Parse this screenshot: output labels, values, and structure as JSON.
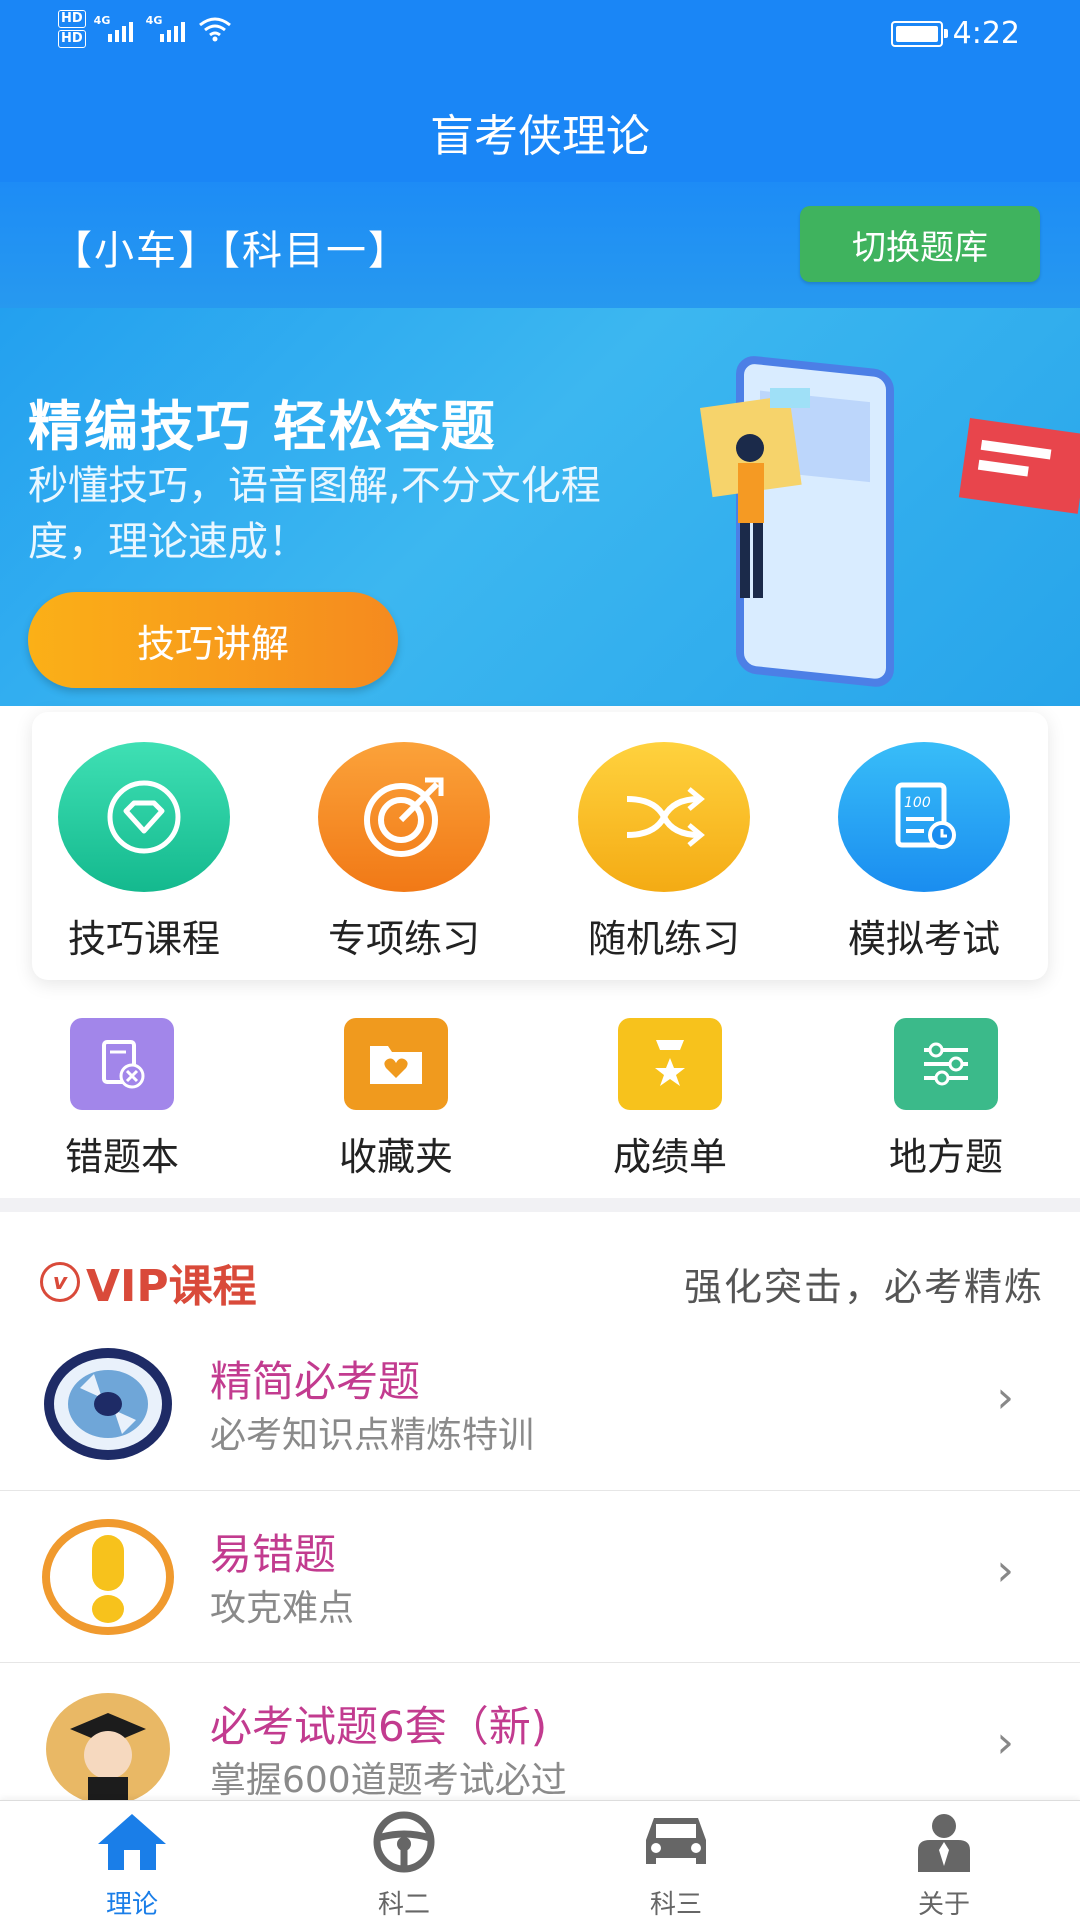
{
  "status": {
    "time": "4:22",
    "hd1": "HD",
    "hd2": "HD",
    "net1": "4G",
    "net2": "4G"
  },
  "app": {
    "title": "盲考侠理论"
  },
  "subject": {
    "label": "【小车】【科目一】",
    "switch": "切换题库"
  },
  "banner": {
    "title": "精编技巧 轻松答题",
    "subtitle": "秒懂技巧，语音图解,不分文化程度，理论速成！",
    "button": "技巧讲解"
  },
  "functions": [
    {
      "label": "技巧课程",
      "icon": "diamond-icon",
      "color": "#22c9a1"
    },
    {
      "label": "专项练习",
      "icon": "target-icon",
      "color": "#f58a1f"
    },
    {
      "label": "随机练习",
      "icon": "shuffle-icon",
      "color": "#f7b818"
    },
    {
      "label": "模拟考试",
      "icon": "exam-paper-icon",
      "color": "#1aa3f2"
    }
  ],
  "tools": [
    {
      "label": "错题本",
      "icon": "wrong-book-icon",
      "color": "#9a7de8"
    },
    {
      "label": "收藏夹",
      "icon": "favorite-folder-icon",
      "color": "#f09a1e"
    },
    {
      "label": "成绩单",
      "icon": "scorecard-icon",
      "color": "#f7c21c"
    },
    {
      "label": "地方题",
      "icon": "local-questions-icon",
      "color": "#3bba8a"
    }
  ],
  "vip": {
    "title": "VIP课程",
    "tagline": "强化突击，必考精炼",
    "courses": [
      {
        "title": "精简必考题",
        "desc": "必考知识点精炼特训"
      },
      {
        "title": "易错题",
        "desc": "攻克难点"
      },
      {
        "title": "必考试题6套（新)",
        "desc": "掌握600道题考试必过"
      }
    ]
  },
  "nav": [
    {
      "label": "理论",
      "icon": "home-icon"
    },
    {
      "label": "科二",
      "icon": "steering-wheel-icon"
    },
    {
      "label": "科三",
      "icon": "car-icon"
    },
    {
      "label": "关于",
      "icon": "person-icon"
    }
  ],
  "colors": {
    "primary": "#1a86f6",
    "switch": "#3fb35e",
    "vip": "#d94a3a",
    "course_title": "#c23b8f"
  }
}
